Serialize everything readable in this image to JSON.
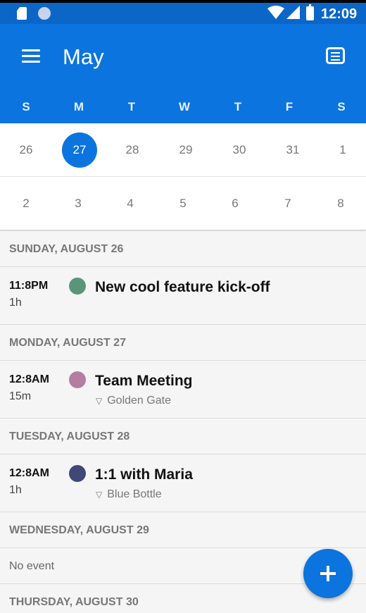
{
  "status_bar": {
    "time": "12:09"
  },
  "header": {
    "month": "May"
  },
  "weekdays": [
    "S",
    "M",
    "T",
    "W",
    "T",
    "F",
    "S"
  ],
  "calendar": {
    "weeks": [
      [
        "26",
        "27",
        "28",
        "29",
        "30",
        "31",
        "1"
      ],
      [
        "2",
        "3",
        "4",
        "5",
        "6",
        "7",
        "8"
      ]
    ],
    "selected_day": "27"
  },
  "agenda": [
    {
      "header": "SUNDAY, AUGUST 26",
      "event": {
        "time": "11:8PM",
        "duration": "1h",
        "title": "New cool feature kick-off",
        "location": "",
        "color": "#5a957b"
      }
    },
    {
      "header": "MONDAY, AUGUST 27",
      "event": {
        "time": "12:8AM",
        "duration": "15m",
        "title": "Team Meeting",
        "location": "Golden Gate",
        "color": "#b57da0"
      }
    },
    {
      "header": "TUESDAY, AUGUST 28",
      "event": {
        "time": "12:8AM",
        "duration": "1h",
        "title": "1:1 with Maria",
        "location": "Blue Bottle",
        "color": "#3f4876"
      }
    },
    {
      "header": "WEDNESDAY, AUGUST 29",
      "no_event": "No event"
    },
    {
      "header": "THURSDAY, AUGUST 30"
    }
  ],
  "colors": {
    "primary": "#0b74de",
    "status_bar": "#0b66c8"
  }
}
